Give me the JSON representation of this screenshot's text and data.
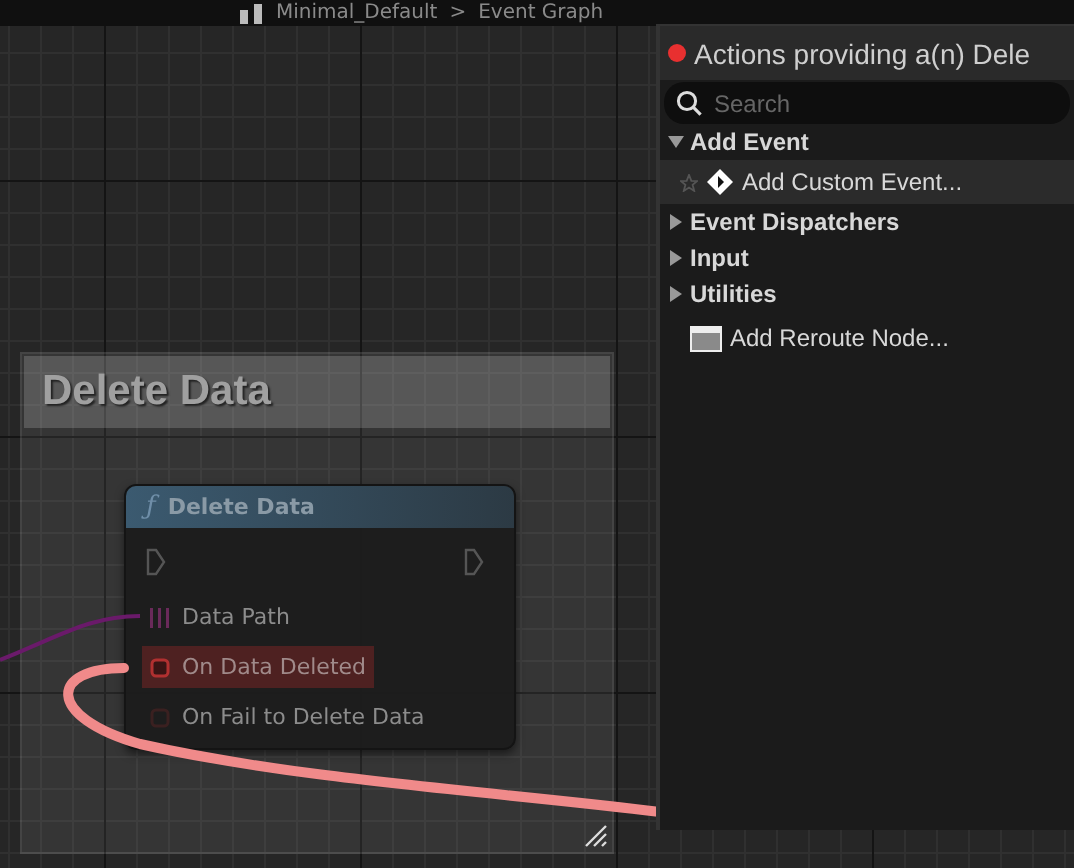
{
  "breadcrumb": {
    "asset": "Minimal_Default",
    "separator": ">",
    "graph": "Event Graph"
  },
  "comment": {
    "title": "Delete Data"
  },
  "node": {
    "icon": "ƒ",
    "title": "Delete Data",
    "pins": [
      {
        "label": "Data Path",
        "kind": "data",
        "connected": true,
        "highlighted": false
      },
      {
        "label": "On Data Deleted",
        "kind": "event",
        "connected": true,
        "highlighted": true
      },
      {
        "label": "On Fail to Delete Data",
        "kind": "event",
        "connected": false,
        "highlighted": false
      }
    ]
  },
  "menu": {
    "title": "Actions providing a(n) Dele",
    "search": {
      "placeholder": "Search"
    },
    "items": [
      {
        "label": "Add Event",
        "kind": "category",
        "expanded": true,
        "children": [
          {
            "label": "Add Custom Event...",
            "kind": "custom-event",
            "highlighted": true
          }
        ]
      },
      {
        "label": "Event Dispatchers",
        "kind": "category",
        "expanded": false
      },
      {
        "label": "Input",
        "kind": "category",
        "expanded": false
      },
      {
        "label": "Utilities",
        "kind": "category",
        "expanded": false
      },
      {
        "label": "Add Reroute Node...",
        "kind": "reroute",
        "highlighted": false
      }
    ]
  }
}
